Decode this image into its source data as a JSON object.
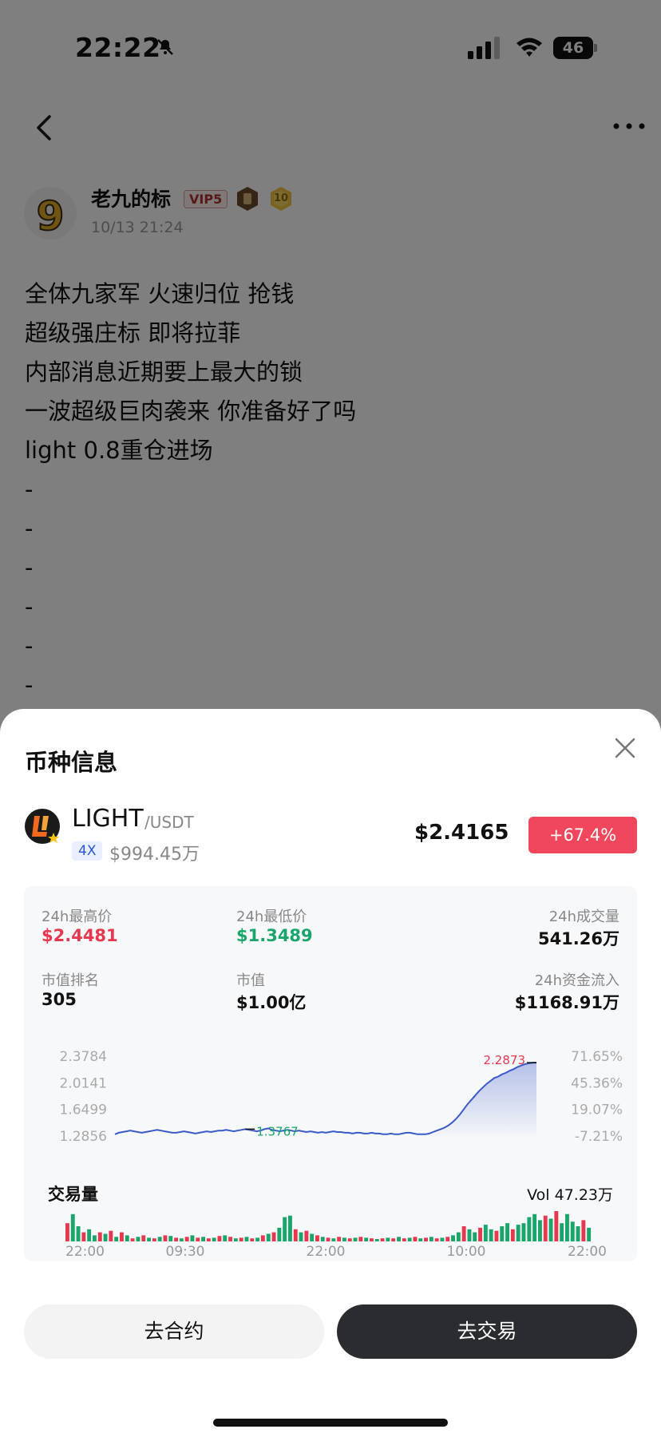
{
  "status_bar": {
    "time": "22:22",
    "battery": "46"
  },
  "post": {
    "author": "老九的标",
    "vip": "VIP5",
    "medal_level": "10",
    "time": "10/13 21:24",
    "lines": [
      "全体九家军 火速归位 抢钱",
      "超级强庄标 即将拉菲",
      "内部消息近期要上最大的锁",
      "一波超级巨肉袭来 你准备好了吗",
      "light 0.8重仓进场",
      "-",
      "-",
      "-",
      "-",
      "-",
      "-"
    ]
  },
  "sheet": {
    "title": "币种信息",
    "coin": {
      "symbol": "LIGHT",
      "pair": "/USDT",
      "leverage": "4X",
      "market_cap_small": "$994.45万",
      "price": "$2.4165",
      "change": "+67.4%"
    },
    "stats": {
      "high_label": "24h最高价",
      "high": "$2.4481",
      "low_label": "24h最低价",
      "low": "$1.3489",
      "volume_label": "24h成交量",
      "volume": "541.26万",
      "rank_label": "市值排名",
      "rank": "305",
      "mcap_label": "市值",
      "mcap": "$1.00亿",
      "inflow_label": "24h资金流入",
      "inflow": "$1168.91万"
    },
    "volume_title": "交易量",
    "volume_total": "Vol 47.23万",
    "buttons": {
      "futures": "去合约",
      "trade": "去交易"
    }
  },
  "colors": {
    "up": "#e6384e",
    "down": "#1aa56b",
    "line": "#3a5bc7",
    "primary_button": "#2a2c30"
  },
  "chart_data": [
    {
      "type": "area",
      "y_ticks": [
        "2.3784",
        "2.0141",
        "1.6499",
        "1.2856"
      ],
      "y2_ticks": [
        "71.65%",
        "45.36%",
        "19.07%",
        "-7.21%"
      ],
      "ylim": [
        1.2856,
        2.3784
      ],
      "annotations": [
        {
          "label": "2.2873",
          "value": 2.2873,
          "kind": "high"
        },
        {
          "label": "1.3767",
          "value": 1.3767,
          "kind": "low"
        }
      ],
      "values": [
        1.31,
        1.33,
        1.34,
        1.35,
        1.36,
        1.35,
        1.34,
        1.33,
        1.34,
        1.35,
        1.36,
        1.37,
        1.36,
        1.35,
        1.34,
        1.33,
        1.33,
        1.34,
        1.35,
        1.34,
        1.33,
        1.32,
        1.33,
        1.34,
        1.35,
        1.34,
        1.35,
        1.36,
        1.36,
        1.37,
        1.36,
        1.35,
        1.36,
        1.37,
        1.38,
        1.37,
        1.36,
        1.35,
        1.36,
        1.38,
        1.39,
        1.37,
        1.36,
        1.35,
        1.36,
        1.37,
        1.36,
        1.35,
        1.36,
        1.35,
        1.34,
        1.35,
        1.34,
        1.33,
        1.34,
        1.33,
        1.34,
        1.35,
        1.34,
        1.34,
        1.33,
        1.33,
        1.32,
        1.33,
        1.33,
        1.32,
        1.32,
        1.33,
        1.32,
        1.32,
        1.31,
        1.31,
        1.32,
        1.31,
        1.31,
        1.32,
        1.33,
        1.33,
        1.32,
        1.31,
        1.31,
        1.31,
        1.32,
        1.34,
        1.36,
        1.38,
        1.4,
        1.43,
        1.47,
        1.52,
        1.58,
        1.65,
        1.72,
        1.78,
        1.84,
        1.9,
        1.95,
        2.0,
        2.04,
        2.08,
        2.1,
        2.13,
        2.15,
        2.18,
        2.2,
        2.23,
        2.25,
        2.27,
        2.28,
        2.29,
        2.29
      ]
    },
    {
      "type": "bar",
      "title": "交易量",
      "x_ticks": [
        "22:00",
        "09:30",
        "22:00",
        "10:00",
        "22:00"
      ],
      "values": [
        0.6,
        0.9,
        0.5,
        0.3,
        0.4,
        0.2,
        0.3,
        0.25,
        0.35,
        0.15,
        0.3,
        0.2,
        0.1,
        0.15,
        0.2,
        0.12,
        0.1,
        0.15,
        0.2,
        0.18,
        0.12,
        0.1,
        0.15,
        0.2,
        0.12,
        0.15,
        0.1,
        0.12,
        0.18,
        0.2,
        0.15,
        0.1,
        0.12,
        0.15,
        0.1,
        0.12,
        0.2,
        0.25,
        0.3,
        0.45,
        0.8,
        0.85,
        0.4,
        0.3,
        0.35,
        0.25,
        0.2,
        0.15,
        0.12,
        0.1,
        0.15,
        0.12,
        0.1,
        0.12,
        0.15,
        0.12,
        0.1,
        0.08,
        0.1,
        0.12,
        0.1,
        0.15,
        0.1,
        0.12,
        0.15,
        0.1,
        0.12,
        0.15,
        0.1,
        0.12,
        0.15,
        0.2,
        0.3,
        0.5,
        0.4,
        0.3,
        0.45,
        0.55,
        0.4,
        0.35,
        0.5,
        0.6,
        0.4,
        0.55,
        0.6,
        0.8,
        0.9,
        0.7,
        0.85,
        0.75,
        1.0,
        0.6,
        0.9,
        0.65,
        0.5,
        0.7,
        0.45
      ],
      "up": [
        0,
        1,
        1,
        0,
        1,
        1,
        0,
        1,
        0,
        1,
        0,
        1,
        0,
        1,
        0,
        1,
        0,
        1,
        0,
        1,
        0,
        1,
        0,
        1,
        0,
        1,
        0,
        1,
        0,
        1,
        0,
        1,
        0,
        1,
        0,
        1,
        0,
        1,
        0,
        1,
        1,
        1,
        0,
        1,
        0,
        1,
        0,
        1,
        0,
        1,
        0,
        1,
        0,
        1,
        0,
        1,
        0,
        1,
        0,
        1,
        0,
        1,
        0,
        1,
        0,
        1,
        0,
        1,
        0,
        1,
        0,
        1,
        1,
        0,
        1,
        1,
        0,
        1,
        1,
        0,
        1,
        1,
        0,
        1,
        1,
        1,
        1,
        1,
        0,
        1,
        0,
        1,
        1,
        1,
        1,
        0,
        1
      ]
    }
  ]
}
